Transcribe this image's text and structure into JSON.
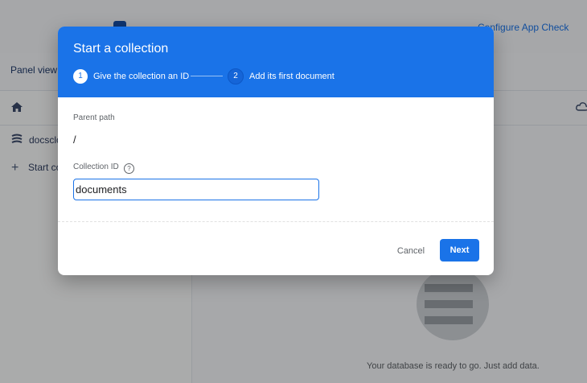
{
  "background": {
    "top_link": "Configure App Check",
    "panel_view": "Panel view",
    "left_items": [
      {
        "label": "docsclo"
      },
      {
        "label": "Start co"
      }
    ],
    "empty_state": "Your database is ready to go. Just add data."
  },
  "dialog": {
    "title": "Start a collection",
    "steps": [
      {
        "number": "1",
        "label": "Give the collection an ID"
      },
      {
        "number": "2",
        "label": "Add its first document"
      }
    ],
    "parent_path_label": "Parent path",
    "parent_path_value": "/",
    "collection_id_label": "Collection ID",
    "help_glyph": "?",
    "collection_id_value": "documents",
    "cancel_label": "Cancel",
    "next_label": "Next"
  },
  "colors": {
    "accent": "#1a73e8",
    "overlay": "rgba(0,0,0,0.32)"
  },
  "icons": [
    "home-icon",
    "database-icon",
    "plus-icon",
    "cloud-icon",
    "help-icon"
  ]
}
